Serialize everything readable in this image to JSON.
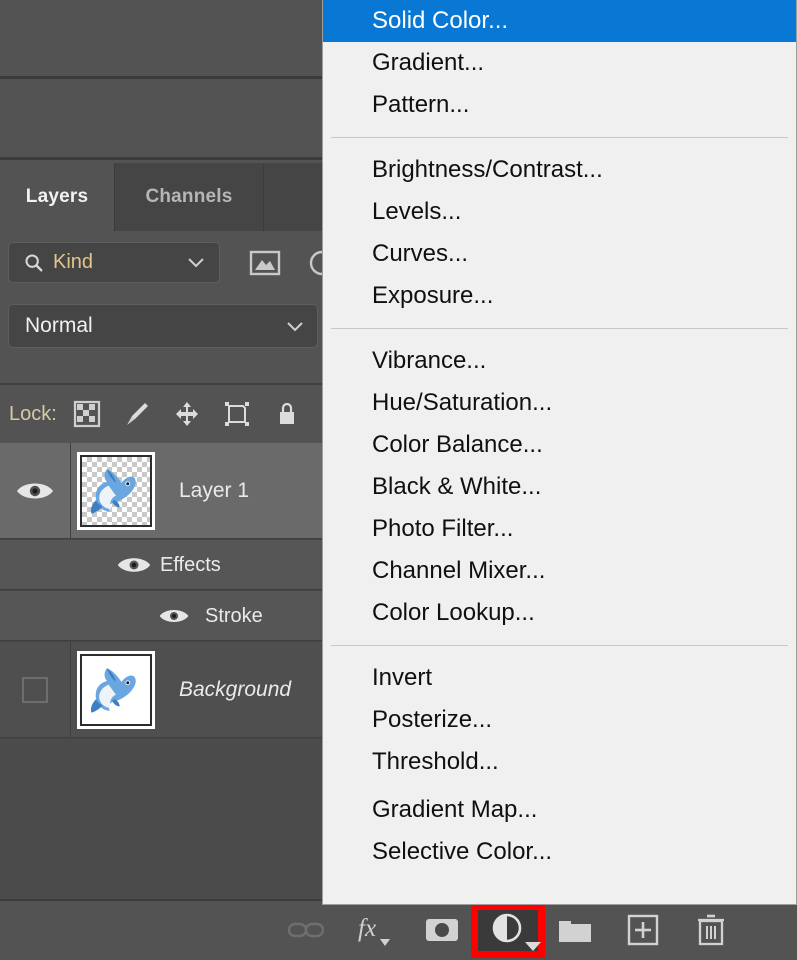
{
  "app": {
    "panel_tabs": [
      {
        "label": "Layers",
        "active": true
      },
      {
        "label": "Channels",
        "active": false
      },
      {
        "label": "",
        "active": false
      }
    ],
    "filter": {
      "kind_label": "Kind",
      "search_icon": "search-icon",
      "caret_icon": "chevron-down-icon",
      "filter_icons": [
        "image-layer-filter-icon",
        "adjustment-layer-filter-icon"
      ]
    },
    "blend": {
      "mode": "Normal",
      "caret_icon": "chevron-down-icon"
    },
    "lock": {
      "label": "Lock:",
      "icons": [
        "transparent-pixels-lock-icon",
        "image-pixels-lock-icon",
        "position-lock-icon",
        "artboard-nesting-lock-icon",
        "lock-all-icon"
      ]
    },
    "layers": [
      {
        "name": "Layer 1",
        "visible": true,
        "selected": true,
        "italic": false,
        "thumb": "transparent-dolphin-thumbnail"
      },
      {
        "name": "Effects",
        "visible": true,
        "kind": "effects-group"
      },
      {
        "name": "Stroke",
        "visible": true,
        "kind": "effect-item"
      },
      {
        "name": "Background",
        "visible": false,
        "selected": false,
        "italic": true,
        "thumb": "white-dolphin-thumbnail"
      }
    ],
    "bottom_toolbar": [
      {
        "name": "link-layers-icon",
        "disabled": true
      },
      {
        "name": "layer-style-fx-icon",
        "disabled": false
      },
      {
        "name": "add-layer-mask-icon",
        "disabled": false
      },
      {
        "name": "new-adjustment-layer-icon",
        "disabled": false,
        "highlighted": true
      },
      {
        "name": "new-group-folder-icon",
        "disabled": false
      },
      {
        "name": "new-layer-icon",
        "disabled": false
      },
      {
        "name": "delete-layer-trash-icon",
        "disabled": false
      }
    ],
    "highlight_color": "#ff0000",
    "accent_color": "#0878d4"
  },
  "context_menu": {
    "name": "new-adjustment-layer-menu",
    "groups": [
      {
        "items": [
          {
            "label": "Solid Color...",
            "selected": true
          },
          {
            "label": "Gradient...",
            "selected": false
          },
          {
            "label": "Pattern...",
            "selected": false
          }
        ]
      },
      {
        "items": [
          {
            "label": "Brightness/Contrast...",
            "selected": false
          },
          {
            "label": "Levels...",
            "selected": false
          },
          {
            "label": "Curves...",
            "selected": false
          },
          {
            "label": "Exposure...",
            "selected": false
          }
        ]
      },
      {
        "items": [
          {
            "label": "Vibrance...",
            "selected": false
          },
          {
            "label": "Hue/Saturation...",
            "selected": false
          },
          {
            "label": "Color Balance...",
            "selected": false
          },
          {
            "label": "Black & White...",
            "selected": false
          },
          {
            "label": "Photo Filter...",
            "selected": false
          },
          {
            "label": "Channel Mixer...",
            "selected": false
          },
          {
            "label": "Color Lookup...",
            "selected": false
          }
        ]
      },
      {
        "items": [
          {
            "label": "Invert",
            "selected": false
          },
          {
            "label": "Posterize...",
            "selected": false
          },
          {
            "label": "Threshold...",
            "selected": false
          }
        ]
      },
      {
        "items": [
          {
            "label": "Gradient Map...",
            "selected": false
          },
          {
            "label": "Selective Color...",
            "selected": false
          }
        ]
      }
    ]
  }
}
